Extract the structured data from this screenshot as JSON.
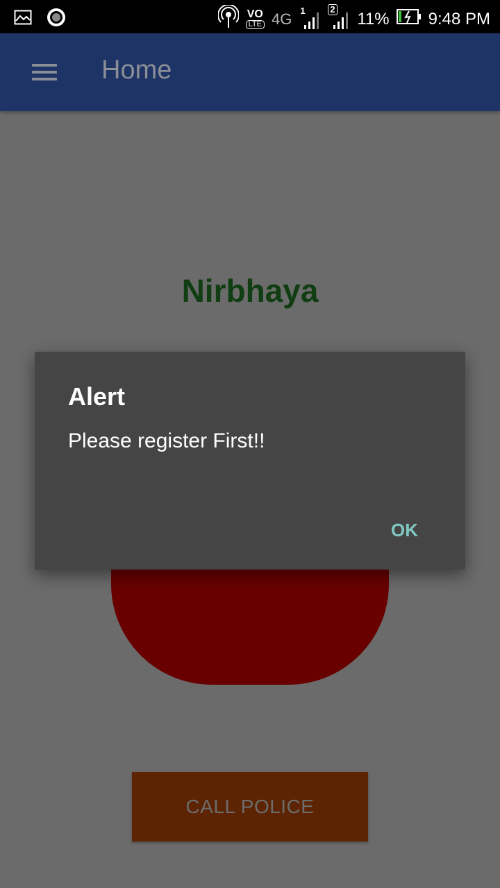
{
  "status_bar": {
    "network_label": "4G",
    "sim1_label": "1",
    "sim2_label": "2",
    "battery": "11%",
    "time": "9:48 PM",
    "volte_label": "VO",
    "lte_label": "LTE"
  },
  "app_bar": {
    "title": "Home",
    "menu_icon": "hamburger-menu-icon",
    "background_color": "#1f3466"
  },
  "main": {
    "brand": "Nirbhaya",
    "brand_color": "#103d12",
    "panic_button_color": "#690000",
    "call_police_label": "CALL POLICE"
  },
  "dialog": {
    "title": "Alert",
    "message": "Please register First!!",
    "ok_label": "OK"
  }
}
